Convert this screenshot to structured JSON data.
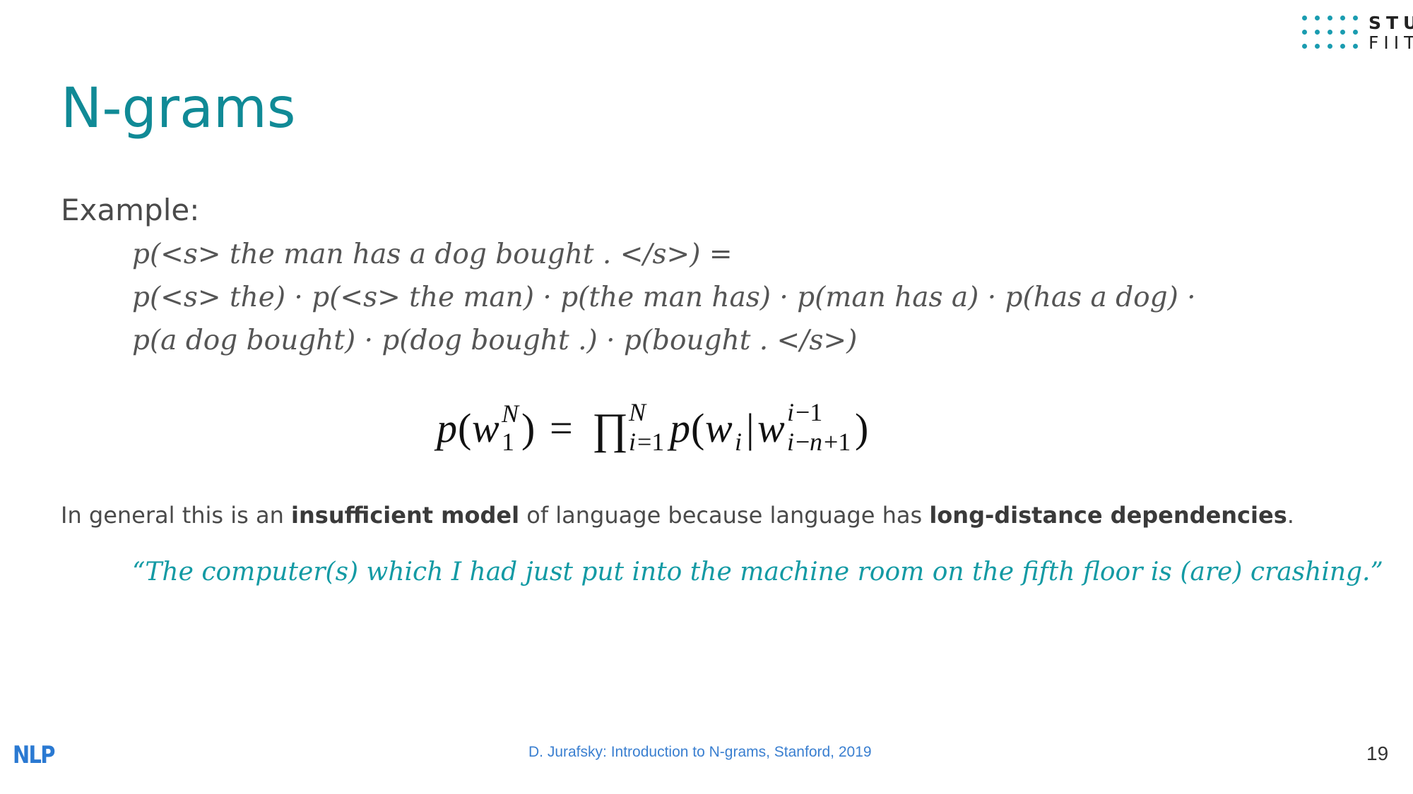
{
  "logo": {
    "line1": "STU",
    "line2": "FIIT",
    "dot_color": "#1a9cb0"
  },
  "slide": {
    "title": "N-grams",
    "example_label": "Example:",
    "example_lines": [
      "p(<s> the man has a dog bought . </s>) =",
      "p(<s> the) · p(<s> the man) · p(the man has) · p(man has a) · p(has a dog) ·",
      "p(a dog bought) · p(dog bought .) · p(bought . </s>)"
    ],
    "general": {
      "part1": "In general this is an ",
      "bold1": "insufficient model",
      "part2": " of language because language has ",
      "bold2": "long-distance dependencies",
      "part3": "."
    },
    "quote": "“The computer(s) which I had just put into the machine room on the fifth floor is (are) crashing.”"
  },
  "footer": {
    "logo": "NLP",
    "reference": "D. Jurafsky: Introduction to N-grams, Stanford, 2019",
    "page_number": "19"
  },
  "colors": {
    "title": "#108a96",
    "quote": "#139aa4",
    "reference": "#3a7fd0",
    "nlp_logo": "#2a79d2"
  }
}
